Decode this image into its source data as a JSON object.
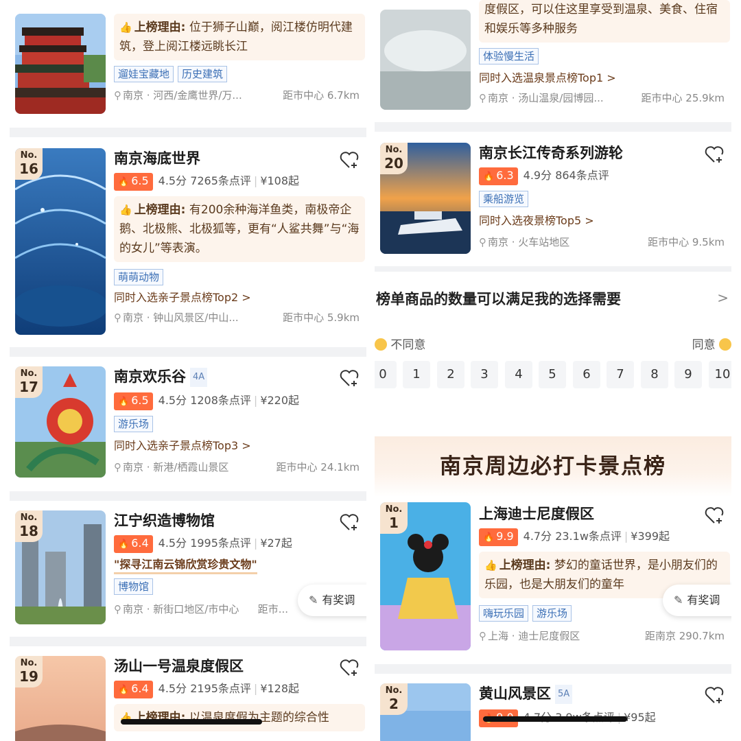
{
  "left": {
    "cards": [
      {
        "reason_label": "上榜理由:",
        "reason": "位于狮子山巅，阅江楼仿明代建筑，登上阅江楼远眺长江",
        "tags": [
          "遛娃宝藏地",
          "历史建筑"
        ],
        "location": "南京 · 河西/金鹰世界/万...",
        "distance": "距市中心 6.7km"
      },
      {
        "rank_no": "No.",
        "rank": "16",
        "title": "南京海底世界",
        "hot": "6.5",
        "score": "4.5分",
        "reviews": "7265条点评",
        "price": "¥108起",
        "reason_label": "上榜理由:",
        "reason": "有200余种海洋鱼类，南极帝企鹅、北极熊、北极狐等，更有“人鲨共舞”与“海的女儿”等表演。",
        "tags": [
          "萌萌动物"
        ],
        "also": "同时入选亲子景点榜Top2 >",
        "location": "南京 · 钟山风景区/中山...",
        "distance": "距市中心 5.9km"
      },
      {
        "rank_no": "No.",
        "rank": "17",
        "title": "南京欢乐谷",
        "level": "4A",
        "hot": "6.5",
        "score": "4.5分",
        "reviews": "1208条点评",
        "price": "¥220起",
        "tags": [
          "游乐场"
        ],
        "also": "同时入选亲子景点榜Top3 >",
        "location": "南京 · 新港/栖霞山景区",
        "distance": "距市中心 24.1km"
      },
      {
        "rank_no": "No.",
        "rank": "18",
        "title": "江宁织造博物馆",
        "hot": "6.4",
        "score": "4.5分",
        "reviews": "1995条点评",
        "price": "¥27起",
        "quote": "\"探寻江南云锦欣赏珍贵文物\"",
        "tags": [
          "博物馆"
        ],
        "location": "南京 · 新街口地区/市中心",
        "distance": "距市..."
      },
      {
        "rank_no": "No.",
        "rank": "19",
        "title": "汤山一号温泉度假区",
        "hot": "6.4",
        "score": "4.5分",
        "reviews": "2195条点评",
        "price": "¥128起",
        "reason_label": "上榜理由:",
        "reason": "以温泉度假为主题的综合性"
      }
    ],
    "survey": "有奖调"
  },
  "right": {
    "cards": [
      {
        "reason": "度假区，可以住这里享受到温泉、美食、住宿和娱乐等多种服务",
        "tags": [
          "体验慢生活"
        ],
        "also": "同时入选温泉景点榜Top1 >",
        "location": "南京 · 汤山温泉/园博园...",
        "distance": "距市中心 25.9km"
      },
      {
        "rank_no": "No.",
        "rank": "20",
        "title": "南京长江传奇系列游轮",
        "hot": "6.3",
        "score": "4.9分",
        "reviews": "864条点评",
        "tags": [
          "乘船游览"
        ],
        "also": "同时入选夜景榜Top5 >",
        "location": "南京 · 火车站地区",
        "distance": "距市中心 9.5km"
      }
    ],
    "question": {
      "title": "榜单商品的数量可以满足我的选择需要",
      "arrow": ">",
      "left_label": "不同意",
      "right_label": "同意",
      "scale": [
        "0",
        "1",
        "2",
        "3",
        "4",
        "5",
        "6",
        "7",
        "8",
        "9",
        "10"
      ]
    },
    "banner": "南京周边必打卡景点榜",
    "cards2": [
      {
        "rank_no": "No.",
        "rank": "1",
        "title": "上海迪士尼度假区",
        "hot": "9.9",
        "score": "4.7分",
        "reviews": "23.1w条点评",
        "price": "¥399起",
        "reason_label": "上榜理由:",
        "reason": "梦幻的童话世界，是小朋友们的乐园，也是大朋友们的童年",
        "tags": [
          "嗨玩乐园",
          "游乐场"
        ],
        "location": "上海 · 迪士尼度假区",
        "distance": "距南京 290.7km"
      },
      {
        "rank_no": "No.",
        "rank": "2",
        "title": "黄山风景区",
        "level": "5A",
        "hot": "9.0",
        "score": "4.7分",
        "reviews": "3.9w条点评",
        "price": "¥95起"
      }
    ],
    "survey": "有奖调"
  },
  "icons": {
    "heart": "heart-plus-icon",
    "pin": "location-pin-icon",
    "fire": "fire-icon",
    "thumb": "thumbs-up-icon",
    "survey": "edit-note-icon"
  },
  "colors": {
    "hot": "#ff6b3d",
    "tag": "#3b6fb5",
    "rank_bg": "#f6e3cf",
    "reason_bg": "#fdf4ec"
  }
}
